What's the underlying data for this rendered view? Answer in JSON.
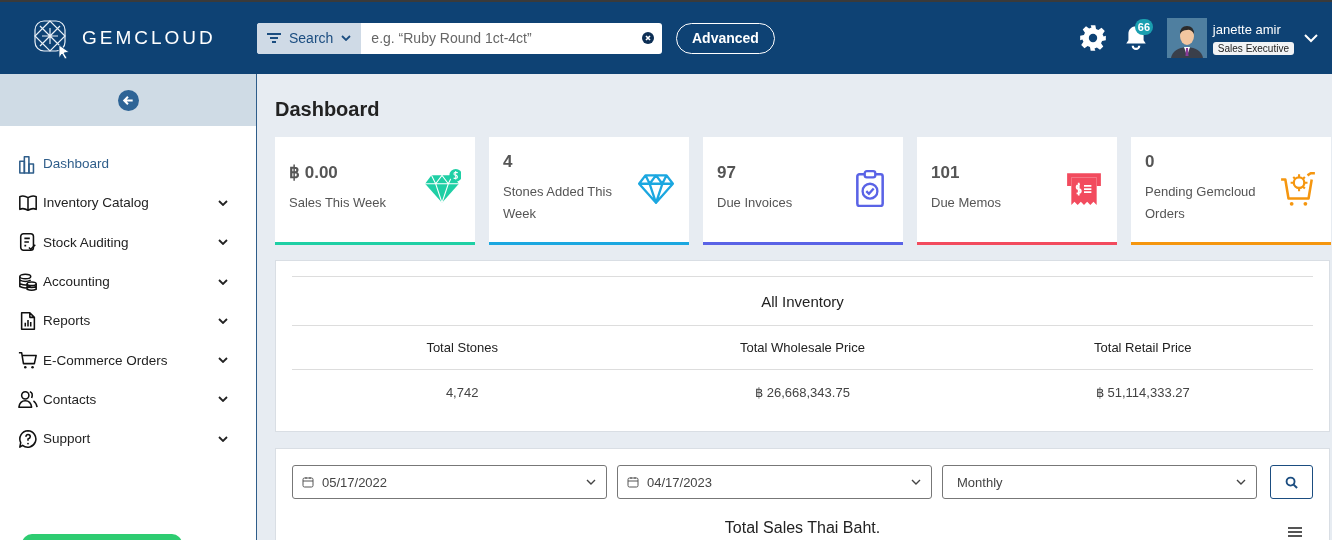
{
  "header": {
    "brand": "GEMCLOUD",
    "search": {
      "mode": "Search",
      "placeholder": "e.g. “Ruby Round 1ct-4ct”"
    },
    "advanced_button": "Advanced",
    "notifications": "66",
    "user": {
      "name": "janette amir",
      "role": "Sales Executive"
    }
  },
  "sidebar": {
    "items": [
      {
        "label": "Dashboard",
        "selected": true,
        "expandable": false
      },
      {
        "label": "Inventory Catalog",
        "selected": false,
        "expandable": true
      },
      {
        "label": "Stock Auditing",
        "selected": false,
        "expandable": true
      },
      {
        "label": "Accounting",
        "selected": false,
        "expandable": true
      },
      {
        "label": "Reports",
        "selected": false,
        "expandable": true
      },
      {
        "label": "E-Commerce Orders",
        "selected": false,
        "expandable": true
      },
      {
        "label": "Contacts",
        "selected": false,
        "expandable": true
      },
      {
        "label": "Support",
        "selected": false,
        "expandable": true
      }
    ]
  },
  "page_title": "Dashboard",
  "cards": [
    {
      "value": "฿ 0.00",
      "label": "Sales This Week",
      "color": "#1fcfa5"
    },
    {
      "value": "4",
      "label": "Stones Added This Week",
      "color": "#1ba7e0"
    },
    {
      "value": "97",
      "label": "Due Invoices",
      "color": "#5a63e6"
    },
    {
      "value": "101",
      "label": "Due Memos",
      "color": "#f24b5e"
    },
    {
      "value": "0",
      "label": "Pending Gemcloud Orders",
      "color": "#f5960f"
    }
  ],
  "inventory": {
    "title": "All Inventory",
    "columns": [
      "Total Stones",
      "Total Wholesale Price",
      "Total Retail Price"
    ],
    "row": [
      "4,742",
      "฿ 26,668,343.75",
      "฿ 51,114,333.27"
    ]
  },
  "filters": {
    "start_date": "05/17/2022",
    "end_date": "04/17/2023",
    "period": "Monthly",
    "chart_title": "Total Sales Thai Baht."
  }
}
